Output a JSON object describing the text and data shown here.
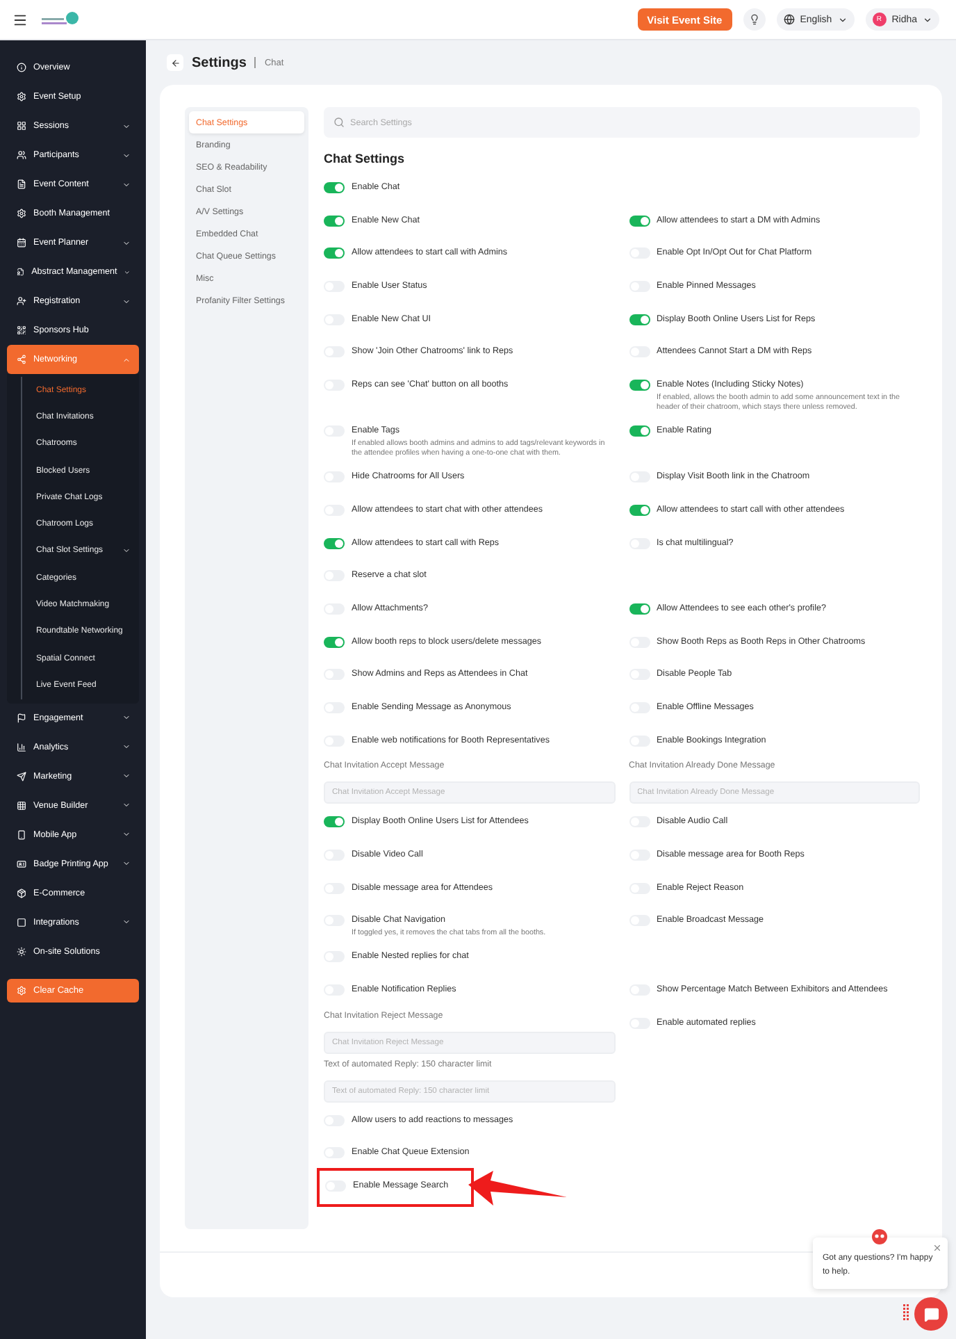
{
  "topbar": {
    "visit_button": "Visit Event Site",
    "language": "English",
    "user": {
      "initial": "R",
      "name": "Ridha"
    }
  },
  "sidebar": {
    "items": [
      {
        "label": "Overview",
        "expandable": false,
        "selected": false
      },
      {
        "label": "Event Setup",
        "expandable": false,
        "selected": false
      },
      {
        "label": "Sessions",
        "expandable": true,
        "selected": false
      },
      {
        "label": "Participants",
        "expandable": true,
        "selected": false
      },
      {
        "label": "Event Content",
        "expandable": true,
        "selected": false
      },
      {
        "label": "Booth Management",
        "expandable": false,
        "selected": false
      },
      {
        "label": "Event Planner",
        "expandable": true,
        "selected": false
      },
      {
        "label": "Abstract Management",
        "expandable": true,
        "selected": false
      },
      {
        "label": "Registration",
        "expandable": true,
        "selected": false
      },
      {
        "label": "Sponsors Hub",
        "expandable": false,
        "selected": false
      },
      {
        "label": "Networking",
        "expandable": true,
        "selected": true,
        "children": [
          {
            "label": "Chat Settings",
            "selected": true,
            "expandable": false
          },
          {
            "label": "Chat Invitations",
            "selected": false,
            "expandable": false
          },
          {
            "label": "Chatrooms",
            "selected": false,
            "expandable": false
          },
          {
            "label": "Blocked Users",
            "selected": false,
            "expandable": false
          },
          {
            "label": "Private Chat Logs",
            "selected": false,
            "expandable": false
          },
          {
            "label": "Chatroom Logs",
            "selected": false,
            "expandable": false
          },
          {
            "label": "Chat Slot Settings",
            "selected": false,
            "expandable": true
          },
          {
            "label": "Categories",
            "selected": false,
            "expandable": false
          },
          {
            "label": "Video Matchmaking",
            "selected": false,
            "expandable": false
          },
          {
            "label": "Roundtable Networking",
            "selected": false,
            "expandable": false
          },
          {
            "label": "Spatial Connect",
            "selected": false,
            "expandable": false
          },
          {
            "label": "Live Event Feed",
            "selected": false,
            "expandable": false
          }
        ]
      },
      {
        "label": "Engagement",
        "expandable": true,
        "selected": false
      },
      {
        "label": "Analytics",
        "expandable": true,
        "selected": false
      },
      {
        "label": "Marketing",
        "expandable": true,
        "selected": false
      },
      {
        "label": "Venue Builder",
        "expandable": true,
        "selected": false
      },
      {
        "label": "Mobile App",
        "expandable": true,
        "selected": false
      },
      {
        "label": "Badge Printing App",
        "expandable": true,
        "selected": false
      },
      {
        "label": "E-Commerce",
        "expandable": false,
        "selected": false
      },
      {
        "label": "Integrations",
        "expandable": true,
        "selected": false
      },
      {
        "label": "On-site Solutions",
        "expandable": false,
        "selected": false
      }
    ],
    "clear_cache": "Clear Cache"
  },
  "page_header": {
    "title": "Settings",
    "crumb": "Chat"
  },
  "settings_nav": [
    {
      "label": "Chat Settings",
      "selected": true
    },
    {
      "label": "Branding",
      "selected": false
    },
    {
      "label": "SEO & Readability",
      "selected": false
    },
    {
      "label": "Chat Slot",
      "selected": false
    },
    {
      "label": "A/V Settings",
      "selected": false
    },
    {
      "label": "Embedded Chat",
      "selected": false
    },
    {
      "label": "Chat Queue Settings",
      "selected": false
    },
    {
      "label": "Misc",
      "selected": false
    },
    {
      "label": "Profanity Filter Settings",
      "selected": false
    }
  ],
  "search": {
    "placeholder": "Search Settings"
  },
  "section_title": "Chat Settings",
  "rows": [
    {
      "left": {
        "kind": "toggle",
        "label": "Enable Chat",
        "on": true
      }
    },
    {
      "left": {
        "kind": "toggle",
        "label": "Enable New Chat",
        "on": true
      },
      "right": {
        "kind": "toggle",
        "label": "Allow attendees to start a DM with Admins",
        "on": true
      }
    },
    {
      "left": {
        "kind": "toggle",
        "label": "Allow attendees to start call with Admins",
        "on": true
      },
      "right": {
        "kind": "toggle",
        "label": "Enable Opt In/Opt Out for Chat Platform",
        "on": false
      }
    },
    {
      "left": {
        "kind": "toggle",
        "label": "Enable User Status",
        "on": false
      },
      "right": {
        "kind": "toggle",
        "label": "Enable Pinned Messages",
        "on": false
      }
    },
    {
      "left": {
        "kind": "toggle",
        "label": "Enable New Chat UI",
        "on": false
      },
      "right": {
        "kind": "toggle",
        "label": "Display Booth Online Users List for Reps",
        "on": true
      }
    },
    {
      "left": {
        "kind": "toggle",
        "label": "Show 'Join Other Chatrooms' link to Reps",
        "on": false
      },
      "right": {
        "kind": "toggle",
        "label": "Attendees Cannot Start a DM with Reps",
        "on": false
      }
    },
    {
      "left": {
        "kind": "toggle",
        "label": "Reps can see 'Chat' button on all booths",
        "on": false
      },
      "right": {
        "kind": "toggle",
        "label": "Enable Notes (Including Sticky Notes)",
        "on": true,
        "description": "If enabled, allows the booth admin to add some announcement text in the header of their chatroom, which stays there unless removed."
      }
    },
    {
      "left": {
        "kind": "toggle",
        "label": "Enable Tags",
        "on": false,
        "description": "If enabled allows booth admins and admins to add tags/relevant keywords in the attendee profiles when having a one-to-one chat with them."
      },
      "right": {
        "kind": "toggle",
        "label": "Enable Rating",
        "on": true
      }
    },
    {
      "left": {
        "kind": "toggle",
        "label": "Hide Chatrooms for All Users",
        "on": false
      },
      "right": {
        "kind": "toggle",
        "label": "Display Visit Booth link in the Chatroom",
        "on": false
      }
    },
    {
      "left": {
        "kind": "toggle",
        "label": "Allow attendees to start chat with other attendees",
        "on": false
      },
      "right": {
        "kind": "toggle",
        "label": "Allow attendees to start call with other attendees",
        "on": true
      }
    },
    {
      "left": {
        "kind": "toggle",
        "label": "Allow attendees to start call with Reps",
        "on": true
      },
      "right": {
        "kind": "toggle",
        "label": "Is chat multilingual?",
        "on": false
      }
    },
    {
      "left": {
        "kind": "toggle",
        "label": "Reserve a chat slot",
        "on": false
      }
    },
    {
      "left": {
        "kind": "toggle",
        "label": "Allow Attachments?",
        "on": false
      },
      "right": {
        "kind": "toggle",
        "label": "Allow Attendees to see each other's profile?",
        "on": true
      }
    },
    {
      "left": {
        "kind": "toggle",
        "label": "Allow booth reps to block users/delete messages",
        "on": true
      },
      "right": {
        "kind": "toggle",
        "label": "Show Booth Reps as Booth Reps in Other Chatrooms",
        "on": false
      }
    },
    {
      "left": {
        "kind": "toggle",
        "label": "Show Admins and Reps as Attendees in Chat",
        "on": false
      },
      "right": {
        "kind": "toggle",
        "label": "Disable People Tab",
        "on": false
      }
    },
    {
      "left": {
        "kind": "toggle",
        "label": "Enable Sending Message as Anonymous",
        "on": false
      },
      "right": {
        "kind": "toggle",
        "label": "Enable Offline Messages",
        "on": false
      }
    },
    {
      "left": {
        "kind": "toggle",
        "label": "Enable web notifications for Booth Representatives",
        "on": false
      },
      "right": {
        "kind": "toggle",
        "label": "Enable Bookings Integration",
        "on": false
      }
    },
    {
      "left": {
        "kind": "field",
        "label": "Chat Invitation Accept Message",
        "placeholder": "Chat Invitation Accept Message"
      },
      "right": {
        "kind": "field",
        "label": "Chat Invitation Already Done Message",
        "placeholder": "Chat Invitation Already Done Message"
      }
    },
    {
      "left": {
        "kind": "toggle",
        "label": "Display Booth Online Users List for Attendees",
        "on": true
      },
      "right": {
        "kind": "toggle",
        "label": "Disable Audio Call",
        "on": false
      }
    },
    {
      "left": {
        "kind": "toggle",
        "label": "Disable Video Call",
        "on": false
      },
      "right": {
        "kind": "toggle",
        "label": "Disable message area for Booth Reps",
        "on": false
      }
    },
    {
      "left": {
        "kind": "toggle",
        "label": "Disable message area for Attendees",
        "on": false
      },
      "right": {
        "kind": "toggle",
        "label": "Enable Reject Reason",
        "on": false
      }
    },
    {
      "left": {
        "kind": "toggle",
        "label": "Disable Chat Navigation",
        "on": false,
        "description": "If toggled yes, it removes the chat tabs from all the booths."
      },
      "right": {
        "kind": "toggle",
        "label": "Enable Broadcast Message",
        "on": false
      }
    },
    {
      "left": {
        "kind": "toggle",
        "label": "Enable Nested replies for chat",
        "on": false
      }
    },
    {
      "left": {
        "kind": "toggle",
        "label": "Enable Notification Replies",
        "on": false
      },
      "right": {
        "kind": "toggle",
        "label": "Show Percentage Match Between Exhibitors and Attendees",
        "on": false
      }
    },
    {
      "left": {
        "kind": "field",
        "label": "Chat Invitation Reject Message",
        "placeholder": "Chat Invitation Reject Message"
      },
      "right": {
        "kind": "toggle",
        "label": "Enable automated replies",
        "on": false
      }
    },
    {
      "left": {
        "kind": "field",
        "label": "Text of automated Reply: 150 character limit",
        "placeholder": "Text of automated Reply: 150 character limit"
      }
    },
    {
      "left": {
        "kind": "toggle",
        "label": "Allow users to add reactions to messages",
        "on": false
      }
    },
    {
      "left": {
        "kind": "toggle",
        "label": "Enable Chat Queue Extension",
        "on": false
      }
    },
    {
      "left": {
        "kind": "toggle",
        "label": "Enable Message Search",
        "on": false,
        "highlighted": true
      }
    }
  ],
  "chat_popup": {
    "message": "Got any questions? I'm happy to help."
  }
}
